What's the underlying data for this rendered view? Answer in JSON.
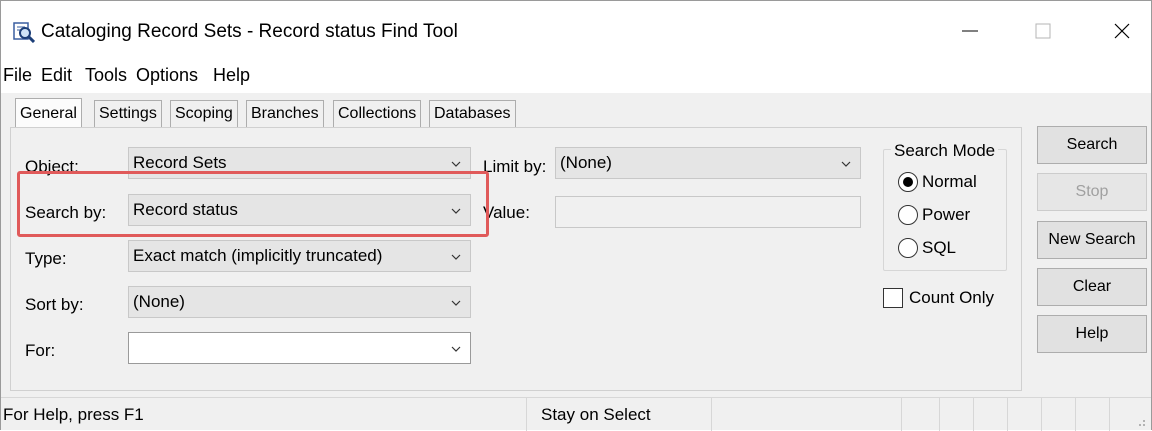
{
  "window": {
    "title": "Cataloging Record Sets - Record status Find Tool",
    "app_icon": "magnifier-book-icon"
  },
  "menu": [
    "File",
    "Edit",
    "Tools",
    "Options",
    "Help"
  ],
  "tabs": [
    "General",
    "Settings",
    "Scoping",
    "Branches",
    "Collections",
    "Databases"
  ],
  "active_tab": "General",
  "form": {
    "object_label": "Object:",
    "object_value": "Record Sets",
    "search_by_label": "Search by:",
    "search_by_value": "Record status",
    "type_label": "Type:",
    "type_value": "Exact match (implicitly truncated)",
    "sort_by_label": "Sort by:",
    "sort_by_value": "(None)",
    "for_label": "For:",
    "for_value": "",
    "limit_by_label": "Limit by:",
    "limit_by_value": "(None)",
    "value_label": "Value:",
    "value_value": ""
  },
  "search_mode": {
    "title": "Search Mode",
    "options": [
      "Normal",
      "Power",
      "SQL"
    ],
    "selected": "Normal"
  },
  "count_only": {
    "label": "Count Only",
    "checked": false
  },
  "buttons": {
    "search": "Search",
    "stop": "Stop",
    "new_search": "New Search",
    "clear": "Clear",
    "help": "Help"
  },
  "status": {
    "help_text": "For Help, press F1",
    "mode_text": "Stay on Select"
  },
  "colors": {
    "highlight_border": "#e05a5a",
    "window_bg": "#f0f0f0"
  }
}
